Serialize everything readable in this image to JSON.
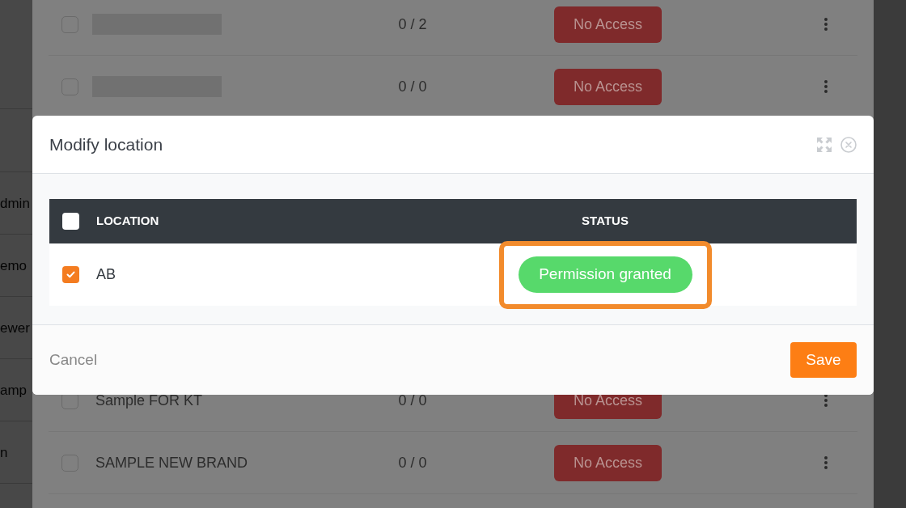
{
  "sidebar": {
    "items": [
      {
        "label": "dmin"
      },
      {
        "label": "emo"
      },
      {
        "label": "ewer"
      },
      {
        "label": "amp"
      },
      {
        "label": "n"
      }
    ]
  },
  "table": {
    "rows_above_dialog": [
      {
        "kind": "redacted",
        "checked": false,
        "count": "0 / 2",
        "access": "No Access"
      },
      {
        "kind": "redacted",
        "checked": false,
        "count": "0 / 0",
        "access": "No Access"
      }
    ],
    "rows_below_dialog": [
      {
        "kind": "named",
        "name": "Sample FOR KT",
        "checked": false,
        "count": "0 / 0",
        "access": "No Access"
      },
      {
        "kind": "named",
        "name": "SAMPLE NEW BRAND",
        "checked": false,
        "count": "0 / 0",
        "access": "No Access"
      }
    ]
  },
  "dialog": {
    "title": "Modify location",
    "table": {
      "select_all": {
        "checked": false
      },
      "columns": [
        "LOCATION",
        "STATUS"
      ],
      "rows": [
        {
          "location": "AB",
          "checked": true,
          "status": "Permission granted",
          "highlighted": true
        }
      ]
    },
    "buttons": {
      "cancel": "Cancel",
      "save": "Save"
    }
  }
}
